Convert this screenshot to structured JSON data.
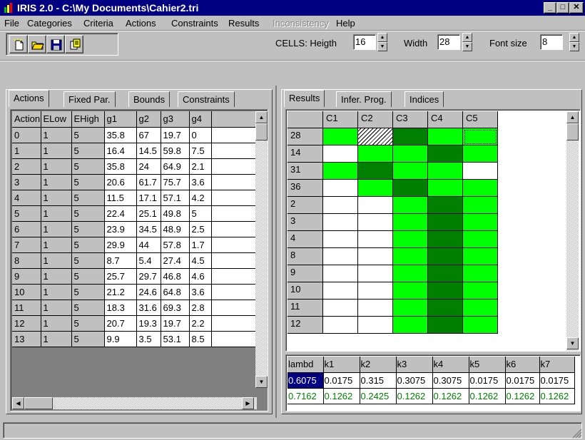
{
  "window": {
    "title": "IRIS 2.0  -  C:\\My Documents\\Cahier2.tri"
  },
  "menu": [
    {
      "label": "File",
      "enabled": true
    },
    {
      "label": "Categories",
      "enabled": true
    },
    {
      "label": "Criteria",
      "enabled": true
    },
    {
      "label": "Actions",
      "enabled": true
    },
    {
      "label": "Constraints",
      "enabled": true
    },
    {
      "label": "Results",
      "enabled": true
    },
    {
      "label": "Inconsistency",
      "enabled": false
    },
    {
      "label": "Help",
      "enabled": true
    }
  ],
  "toolbar": {
    "icons": [
      "new-icon",
      "open-folder-icon",
      "save-disk-icon",
      "copy-icon"
    ],
    "cells_label": "CELLS: Heigth",
    "height_value": "16",
    "width_label": "Width",
    "width_value": "28",
    "fontsize_label": "Font size",
    "fontsize_value": "8"
  },
  "left": {
    "tabs": [
      "Actions",
      "Fixed Par.",
      "Bounds",
      "Constraints"
    ],
    "active_tab": 0,
    "headers": [
      "Action",
      "ELow",
      "EHigh",
      "g1",
      "g2",
      "g3",
      "g4"
    ],
    "rows": [
      [
        "0",
        "1",
        "5",
        "35.8",
        "67",
        "19.7",
        "0"
      ],
      [
        "1",
        "1",
        "5",
        "16.4",
        "14.5",
        "59.8",
        "7.5"
      ],
      [
        "2",
        "1",
        "5",
        "35.8",
        "24",
        "64.9",
        "2.1"
      ],
      [
        "3",
        "1",
        "5",
        "20.6",
        "61.7",
        "75.7",
        "3.6"
      ],
      [
        "4",
        "1",
        "5",
        "11.5",
        "17.1",
        "57.1",
        "4.2"
      ],
      [
        "5",
        "1",
        "5",
        "22.4",
        "25.1",
        "49.8",
        "5"
      ],
      [
        "6",
        "1",
        "5",
        "23.9",
        "34.5",
        "48.9",
        "2.5"
      ],
      [
        "7",
        "1",
        "5",
        "29.9",
        "44",
        "57.8",
        "1.7"
      ],
      [
        "8",
        "1",
        "5",
        "8.7",
        "5.4",
        "27.4",
        "4.5"
      ],
      [
        "9",
        "1",
        "5",
        "25.7",
        "29.7",
        "46.8",
        "4.6"
      ],
      [
        "10",
        "1",
        "5",
        "21.2",
        "24.6",
        "64.8",
        "3.6"
      ],
      [
        "11",
        "1",
        "5",
        "18.3",
        "31.6",
        "69.3",
        "2.8"
      ],
      [
        "12",
        "1",
        "5",
        "20.7",
        "19.3",
        "19.7",
        "2.2"
      ],
      [
        "13",
        "1",
        "5",
        "9.9",
        "3.5",
        "53.1",
        "8.5"
      ]
    ]
  },
  "right": {
    "tabs": [
      "Results",
      "Infer. Prog.",
      "Indices"
    ],
    "active_tab": 0,
    "col_headers": [
      "C1",
      "C2",
      "C3",
      "C4",
      "C5"
    ],
    "colors": {
      "bright": "#00ff00",
      "dark": "#008000",
      "empty": "#ffffff"
    },
    "rows": [
      {
        "label": "28",
        "cells": [
          "bright",
          "hatch",
          "dark",
          "bright",
          "bright-dotted"
        ]
      },
      {
        "label": "14",
        "cells": [
          "empty",
          "bright",
          "bright",
          "dark",
          "bright"
        ]
      },
      {
        "label": "31",
        "cells": [
          "bright",
          "dark",
          "bright",
          "bright",
          "empty"
        ]
      },
      {
        "label": "36",
        "cells": [
          "empty",
          "bright",
          "dark",
          "bright",
          "bright"
        ]
      },
      {
        "label": "2",
        "cells": [
          "empty",
          "empty",
          "bright",
          "dark",
          "bright"
        ]
      },
      {
        "label": "3",
        "cells": [
          "empty",
          "empty",
          "bright",
          "dark",
          "bright"
        ]
      },
      {
        "label": "4",
        "cells": [
          "empty",
          "empty",
          "bright",
          "dark",
          "bright"
        ]
      },
      {
        "label": "8",
        "cells": [
          "empty",
          "empty",
          "bright",
          "dark",
          "bright"
        ]
      },
      {
        "label": "9",
        "cells": [
          "empty",
          "empty",
          "bright",
          "dark",
          "bright"
        ]
      },
      {
        "label": "10",
        "cells": [
          "empty",
          "empty",
          "bright",
          "dark",
          "bright"
        ]
      },
      {
        "label": "11",
        "cells": [
          "empty",
          "empty",
          "bright",
          "dark",
          "bright"
        ]
      },
      {
        "label": "12",
        "cells": [
          "empty",
          "empty",
          "bright",
          "dark",
          "bright"
        ]
      }
    ],
    "k_headers": [
      "lambd",
      "k1",
      "k2",
      "k3",
      "k4",
      "k5",
      "k6",
      "k7"
    ],
    "k_row1": [
      "0.6075",
      "0.0175",
      "0.315",
      "0.3075",
      "0.3075",
      "0.0175",
      "0.0175",
      "0.0175"
    ],
    "k_row2": [
      "0.7162",
      "0.1262",
      "0.2425",
      "0.1262",
      "0.1262",
      "0.1262",
      "0.1262",
      "0.1262"
    ],
    "k_row2_color": "#008000",
    "k_selected_bg": "#000080"
  }
}
